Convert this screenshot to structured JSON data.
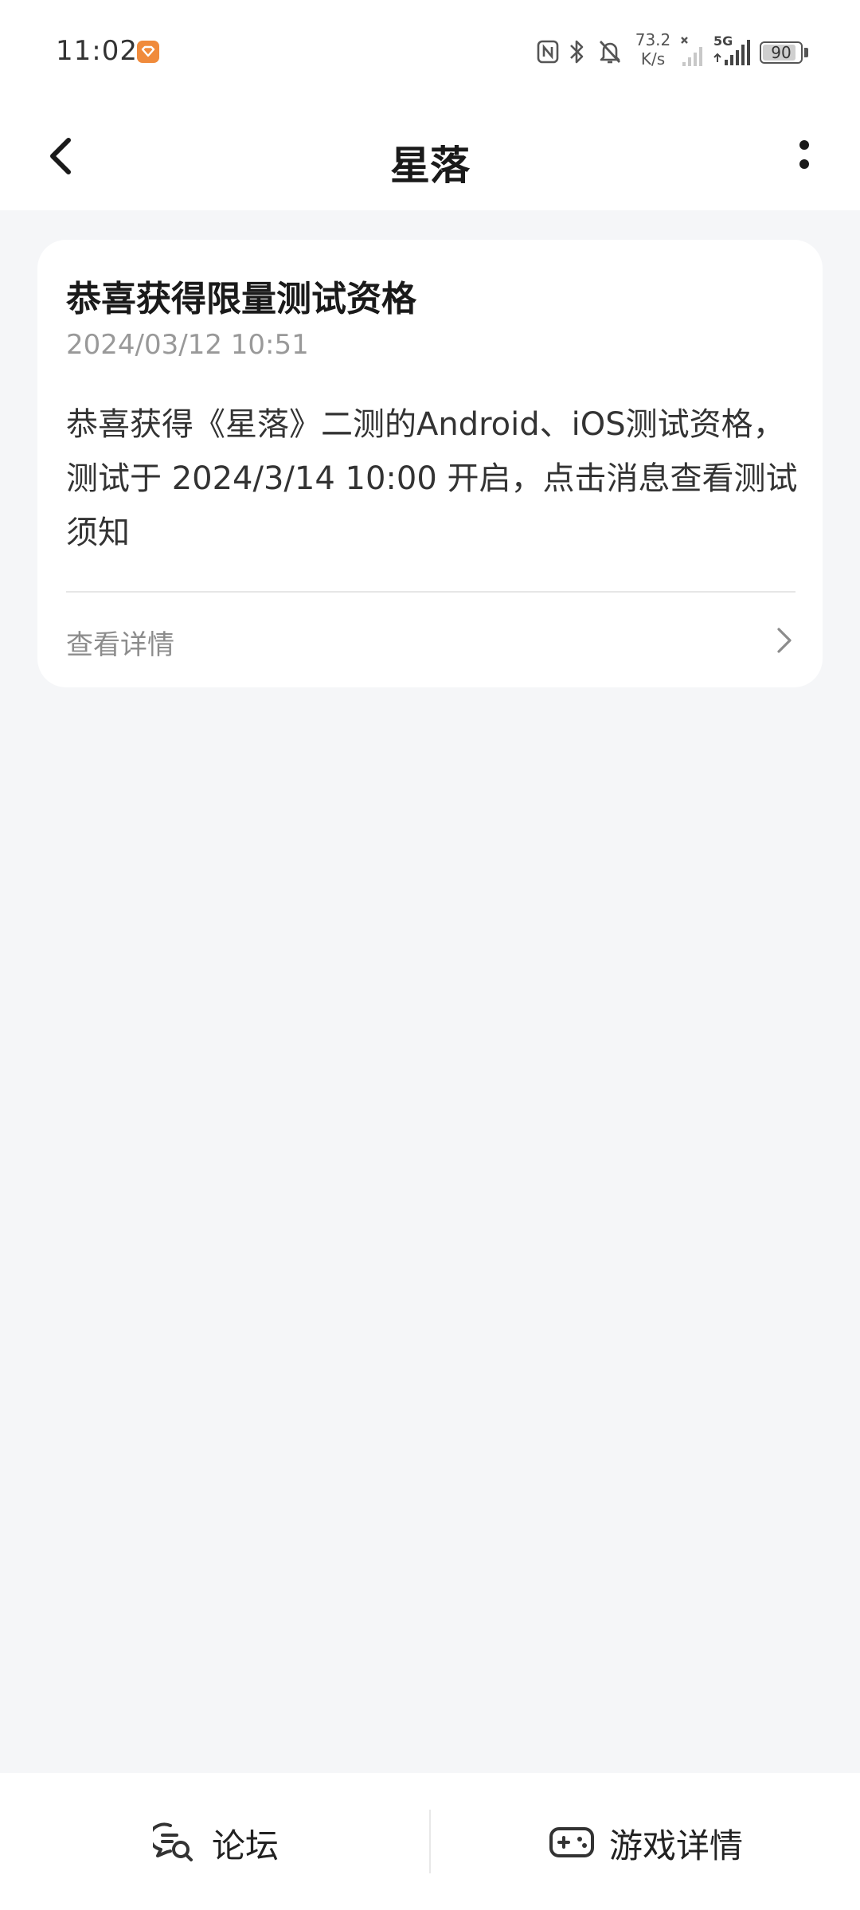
{
  "status_bar": {
    "time": "11:02",
    "net_speed_value": "73.2",
    "net_speed_unit": "K/s",
    "signal_label": "5G",
    "battery": "90",
    "battery_level": 0.9,
    "icons": [
      "nfc-icon",
      "bluetooth-icon",
      "mute-bell-icon",
      "wifi-off-icon",
      "signal-icon",
      "battery-icon"
    ]
  },
  "header": {
    "title": "星落"
  },
  "message": {
    "title": "恭喜获得限量测试资格",
    "time": "2024/03/12 10:51",
    "body": "恭喜获得《星落》二测的Android、iOS测试资格，测试于 2024/3/14 10:00 开启，点击消息查看测试须知",
    "link_label": "查看详情"
  },
  "bottom_bar": {
    "forum_label": "论坛",
    "game_details_label": "游戏详情"
  },
  "colors": {
    "background": "#f5f6f8",
    "card": "#ffffff",
    "accent_app_icon": "#f08b3c",
    "secondary_text": "#999999"
  }
}
